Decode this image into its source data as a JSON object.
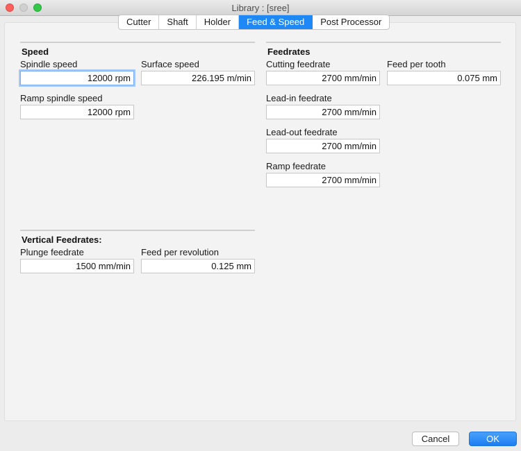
{
  "window": {
    "title": "Library :  [sree]"
  },
  "tabs": [
    {
      "label": "Cutter",
      "active": false
    },
    {
      "label": "Shaft",
      "active": false
    },
    {
      "label": "Holder",
      "active": false
    },
    {
      "label": "Feed & Speed",
      "active": true
    },
    {
      "label": "Post Processor",
      "active": false
    }
  ],
  "speed": {
    "title": "Speed",
    "spindle_speed": {
      "label": "Spindle speed",
      "value": "12000 rpm"
    },
    "surface_speed": {
      "label": "Surface speed",
      "value": "226.195 m/min"
    },
    "ramp_spindle_speed": {
      "label": "Ramp spindle speed",
      "value": "12000 rpm"
    }
  },
  "feedrates": {
    "title": "Feedrates",
    "cutting_feedrate": {
      "label": "Cutting feedrate",
      "value": "2700 mm/min"
    },
    "feed_per_tooth": {
      "label": "Feed per tooth",
      "value": "0.075 mm"
    },
    "lead_in_feedrate": {
      "label": "Lead-in feedrate",
      "value": "2700 mm/min"
    },
    "lead_out_feedrate": {
      "label": "Lead-out feedrate",
      "value": "2700 mm/min"
    },
    "ramp_feedrate": {
      "label": "Ramp feedrate",
      "value": "2700 mm/min"
    }
  },
  "vertical": {
    "title": "Vertical Feedrates:",
    "plunge_feedrate": {
      "label": "Plunge feedrate",
      "value": "1500 mm/min"
    },
    "feed_per_revolution": {
      "label": "Feed per revolution",
      "value": "0.125 mm"
    }
  },
  "buttons": {
    "cancel": "Cancel",
    "ok": "OK"
  },
  "colors": {
    "accent": "#1e88f7",
    "close": "#fc605c",
    "maximize": "#34c84a"
  }
}
